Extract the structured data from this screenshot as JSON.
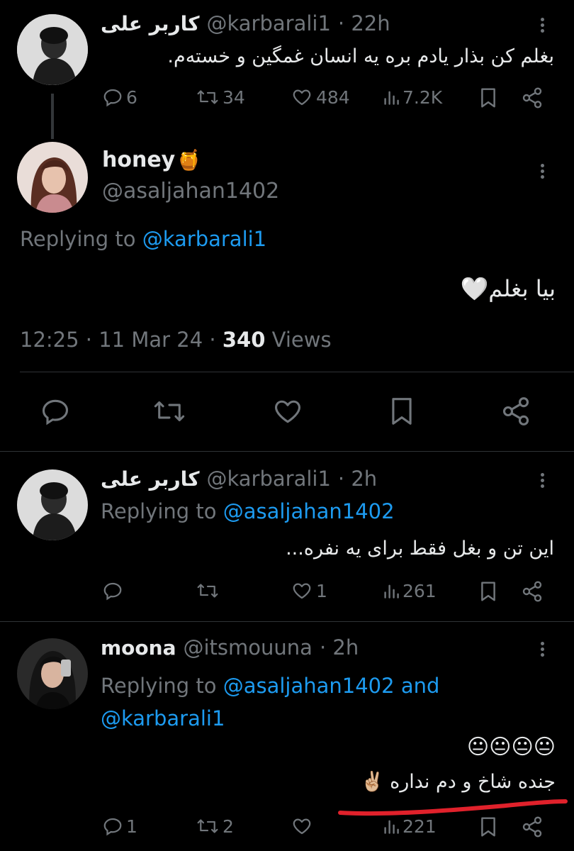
{
  "thread": {
    "tweet1": {
      "display_name": "کاربر علی",
      "handle": "@karbarali1",
      "time": "· 22h",
      "text": "بغلم کن بذار یادم بره یه انسان غمگین و خستەم.",
      "replies": "6",
      "retweets": "34",
      "likes": "484",
      "views": "7.2K"
    },
    "main": {
      "display_name": "honey",
      "name_emoji": "🍯",
      "handle": "@asaljahan1402",
      "replying_label": "Replying to",
      "replying_to": "@karbarali1",
      "text": "بیا بغلم",
      "text_emoji": "🤍",
      "time": "12:25",
      "date": "11 Mar 24",
      "views_count": "340",
      "views_label": "Views"
    },
    "reply1": {
      "display_name": "کاربر علی",
      "handle": "@karbarali1",
      "time": "· 2h",
      "replying_label": "Replying to",
      "replying_to": "@asaljahan1402",
      "text": "این تن و بغل فقط برای یه نفره...",
      "replies": "",
      "retweets": "",
      "likes": "1",
      "views": "261"
    },
    "reply2": {
      "display_name": "moona",
      "handle": "@itsmouuna",
      "time": "· 2h",
      "replying_label": "Replying to",
      "replying_to_1": "@asaljahan1402",
      "and_label": "and",
      "replying_to_2": "@karbarali1",
      "emoji_line": "😐😐😐😐",
      "text": "جنده شاخ و دم نداره",
      "text_emoji": "✌🏼",
      "replies": "1",
      "retweets": "2",
      "likes": "",
      "views": "221"
    }
  },
  "colors": {
    "background": "#000000",
    "text": "#e7e9ea",
    "muted": "#71767b",
    "link": "#1d9bf0",
    "divider": "#2f3336",
    "underline": "#e0212b"
  },
  "icons": [
    "reply-icon",
    "retweet-icon",
    "like-icon",
    "views-icon",
    "bookmark-icon",
    "share-icon",
    "more-icon"
  ]
}
